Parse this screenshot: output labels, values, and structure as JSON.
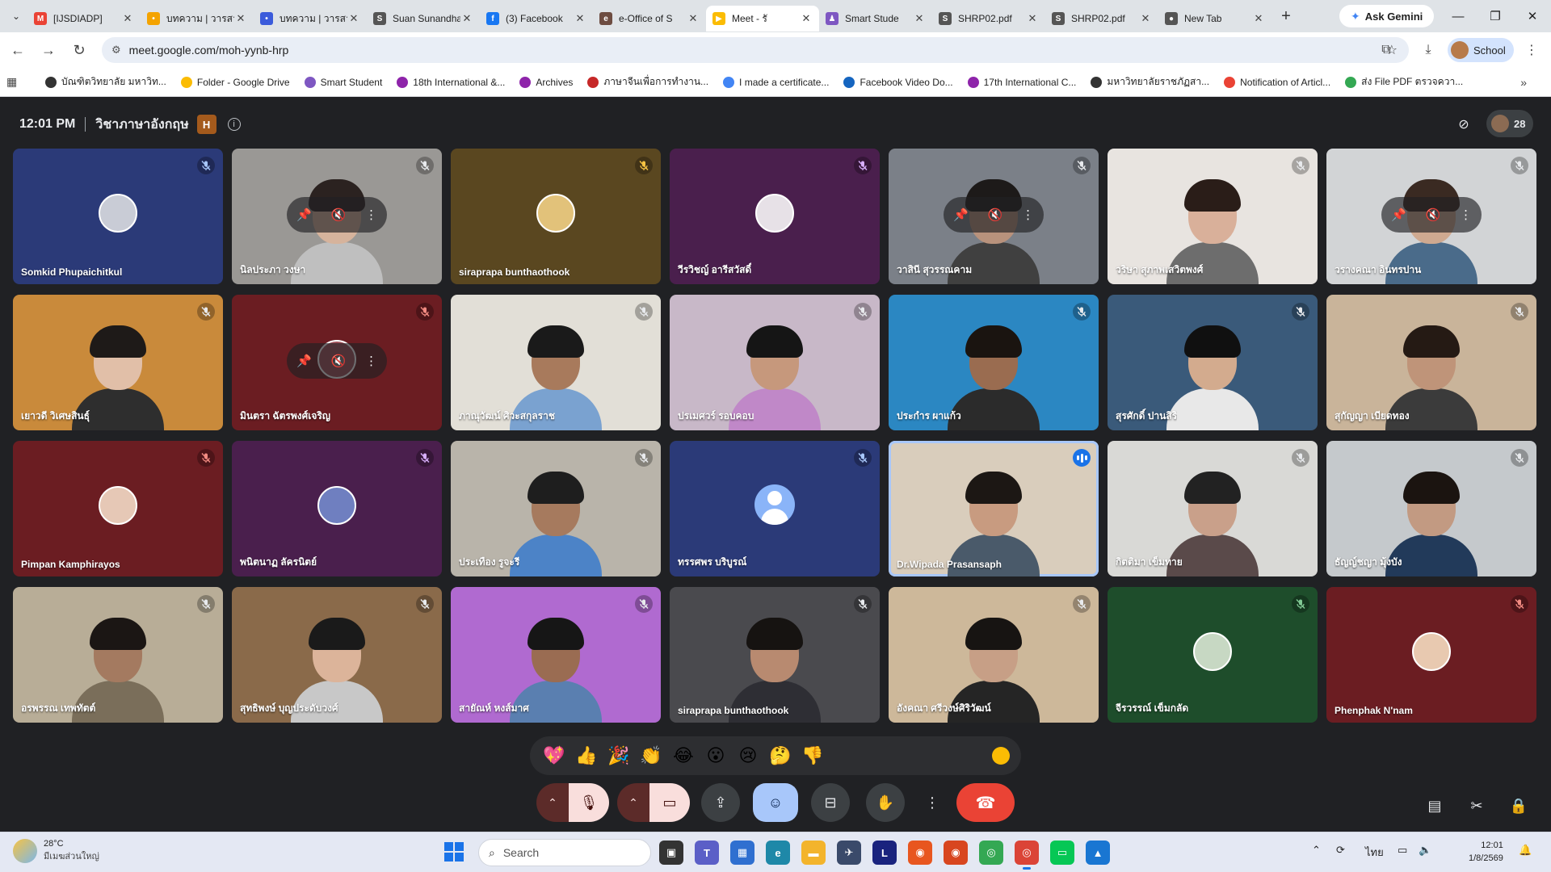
{
  "browser": {
    "tabs": [
      {
        "title": "[IJSDIADP]",
        "favicon": "M",
        "color": "#ea4335",
        "active": false
      },
      {
        "title": "บทความ | วารสาร",
        "favicon": "•",
        "color": "#f4a300",
        "active": false
      },
      {
        "title": "บทความ | วารสาร",
        "favicon": "•",
        "color": "#3b5bdb",
        "active": false
      },
      {
        "title": "Suan Sunandha",
        "favicon": "S",
        "color": "#555555",
        "active": false
      },
      {
        "title": "(3) Facebook",
        "favicon": "f",
        "color": "#1877f2",
        "active": false
      },
      {
        "title": "e-Office of S",
        "favicon": "e",
        "color": "#6d4c41",
        "active": false
      },
      {
        "title": "Meet - รั",
        "favicon": "▶",
        "color": "#fbbc04",
        "active": true
      },
      {
        "title": "Smart Stude",
        "favicon": "♟",
        "color": "#7e57c2",
        "active": false
      },
      {
        "title": "SHRP02.pdf",
        "favicon": "S",
        "color": "#555555",
        "active": false
      },
      {
        "title": "SHRP02.pdf",
        "favicon": "S",
        "color": "#555555",
        "active": false
      },
      {
        "title": "New Tab",
        "favicon": "●",
        "color": "#555555",
        "active": false
      }
    ],
    "close_glyph": "✕",
    "new_tab_glyph": "+",
    "gemini_label": "Ask Gemini",
    "url": "meet.google.com/moh-yynb-hrp",
    "profile_label": "School",
    "bookmarks": [
      {
        "label": "บัณฑิตวิทยาลัย มหาวิท...",
        "color": "#333333"
      },
      {
        "label": "Folder - Google Drive",
        "color": "#fbbc04"
      },
      {
        "label": "Smart Student",
        "color": "#7e57c2"
      },
      {
        "label": "18th International &...",
        "color": "#8e24aa"
      },
      {
        "label": "Archives",
        "color": "#8e24aa"
      },
      {
        "label": "ภาษาจีนเพื่อการทำงาน...",
        "color": "#c62828"
      },
      {
        "label": "I made a certificate...",
        "color": "#4285f4"
      },
      {
        "label": "Facebook Video Do...",
        "color": "#1565c0"
      },
      {
        "label": "17th International C...",
        "color": "#8e24aa"
      },
      {
        "label": "มหาวิทยาลัยราชภัฏสา...",
        "color": "#333333"
      },
      {
        "label": "Notification of Articl...",
        "color": "#ea4335"
      },
      {
        "label": "ส่ง File PDF ตรวจควา...",
        "color": "#34a853"
      }
    ]
  },
  "meet": {
    "time": "12:01 PM",
    "meeting_name": "วิชาภาษาอังกฤษ",
    "participant_count": "28",
    "tiles": [
      {
        "name": "Somkid Phupaichitkul",
        "bg": "#2b3a78",
        "kind": "avatar",
        "avatar": "#c9ccd6",
        "mic": "#a8c7fa"
      },
      {
        "name": "นิลประภา วงษา",
        "bg": "#9a9895",
        "kind": "video",
        "skin": "#d6b39c",
        "hair": "#2b2220",
        "shirt": "#bfbfbf",
        "hover": true
      },
      {
        "name": "siraprapa bunthaothook",
        "bg": "#5a4720",
        "kind": "avatar",
        "avatar": "#e2c27a",
        "mic": "#f6c343"
      },
      {
        "name": "วีรวิชญ์ อารีสวัสดิ์",
        "bg": "#4a1f4d",
        "kind": "avatar",
        "avatar": "#e7e1e7",
        "mic": "#d7aefb"
      },
      {
        "name": "วาสินี สุวรรณคาม",
        "bg": "#7b8088",
        "kind": "video",
        "skin": "#b8927c",
        "hair": "#1d1a19",
        "shirt": "#404040",
        "hover": true
      },
      {
        "name": "วริษา สุภาพเสวิตพงศ์",
        "bg": "#e8e4e0",
        "kind": "video",
        "skin": "#d9b09a",
        "hair": "#2a1d18",
        "shirt": "#6d6d6d"
      },
      {
        "name": "วรางคณา อินทรปาน",
        "bg": "#d2d4d6",
        "kind": "video",
        "skin": "#cfa990",
        "hair": "#3a2a22",
        "shirt": "#4a6b8a",
        "hover": true
      },
      {
        "name": "เยาวดี วิเศษสินธุ์",
        "bg": "#c98a3b",
        "kind": "video",
        "skin": "#e1bfa8",
        "hair": "#1e1a18",
        "shirt": "#2e2e2e"
      },
      {
        "name": "มินตรา ฉัตรพงศ์เจริญ",
        "bg": "#6b1d22",
        "kind": "avatar",
        "avatar": "#a0525a",
        "mic": "#f28b82",
        "hover": true
      },
      {
        "name": "ภาณุวัฒน์ ศิวะสกุลราช",
        "bg": "#e2dfd7",
        "kind": "video",
        "skin": "#a87a5c",
        "hair": "#1a1a1a",
        "shirt": "#7aa2d0"
      },
      {
        "name": "ปรเมศวร์ รอบคอบ",
        "bg": "#c8b8c8",
        "kind": "video",
        "skin": "#c6987c",
        "hair": "#151515",
        "shirt": "#c088c8"
      },
      {
        "name": "ประกำร ผาแก้ว",
        "bg": "#2b87c2",
        "kind": "video",
        "skin": "#9a6c50",
        "hair": "#1a1410",
        "shirt": "#2b2b2b"
      },
      {
        "name": "สุรศักดิ์ ปานสิริ",
        "bg": "#3a5a7a",
        "kind": "video",
        "skin": "#d3ab8e",
        "hair": "#101010",
        "shirt": "#e8e8e8"
      },
      {
        "name": "สุกัญญา เบียดทอง",
        "bg": "#c9b49a",
        "kind": "video",
        "skin": "#bf9479",
        "hair": "#251a14",
        "shirt": "#3b3b3b"
      },
      {
        "name": "Pimpan Kamphirayos",
        "bg": "#6b1d22",
        "kind": "avatar",
        "avatar": "#e6c8b6",
        "mic": "#f28b82"
      },
      {
        "name": "พนิตนาฏ ลัครนิตย์",
        "bg": "#4a1f4d",
        "kind": "avatar",
        "avatar": "#6f7fc0",
        "mic": "#d7aefb"
      },
      {
        "name": "ประเทือง รูจะรี",
        "bg": "#b9b4aa",
        "kind": "video",
        "skin": "#a67a5e",
        "hair": "#1e1e1e",
        "shirt": "#4c83c7"
      },
      {
        "name": "ทรรศพร บริบูรณ์",
        "bg": "#2b3a78",
        "kind": "generic",
        "mic": "#a8c7fa"
      },
      {
        "name": "Dr.Wipada Prasansaph",
        "bg": "#d9cdbc",
        "kind": "video",
        "skin": "#c89b80",
        "hair": "#1c1714",
        "shirt": "#4a5a6a",
        "speaking": true
      },
      {
        "name": "กิตติมา เข็มทาย",
        "bg": "#d9d9d6",
        "kind": "video",
        "skin": "#c9a08a",
        "hair": "#222222",
        "shirt": "#5a4a4a"
      },
      {
        "name": "ธัญญ์ชญา มุ้งบัง",
        "bg": "#c5c9cc",
        "kind": "video",
        "skin": "#c29a82",
        "hair": "#1b1410",
        "shirt": "#223a5a"
      },
      {
        "name": "อรพรรณ เทพทัตต์",
        "bg": "#b8ad97",
        "kind": "video",
        "skin": "#a47a60",
        "hair": "#1b1614",
        "shirt": "#7a6e5a"
      },
      {
        "name": "สุทธิพงษ์ บุญประดับวงศ์",
        "bg": "#8a6a4a",
        "kind": "video",
        "skin": "#dcb49a",
        "hair": "#1a1a1a",
        "shirt": "#c8c8c8"
      },
      {
        "name": "สายัณห์ หงส์มาศ",
        "bg": "#b06ad0",
        "kind": "video",
        "skin": "#9a6c52",
        "hair": "#161616",
        "shirt": "#5a7fb0"
      },
      {
        "name": "siraprapa bunthaothook",
        "bg": "#4a4a4e",
        "kind": "video",
        "skin": "#b88a70",
        "hair": "#161311",
        "shirt": "#2e2e34"
      },
      {
        "name": "อังคณา ศรีวงษ์ศิริวัฒน์",
        "bg": "#cdb89a",
        "kind": "video",
        "skin": "#c79f86",
        "hair": "#171412",
        "shirt": "#252525"
      },
      {
        "name": "จีรวรรณ์ เข็มกลัด",
        "bg": "#1e4d2b",
        "kind": "avatar",
        "avatar": "#c7d8c3",
        "mic": "#81c995"
      },
      {
        "name": "Phenphak N'nam",
        "bg": "#6b1d22",
        "kind": "avatar",
        "avatar": "#e8c9b0",
        "mic": "#f28b82"
      }
    ],
    "reactions": [
      "💖",
      "👍",
      "🎉",
      "👏",
      "😂",
      "😮",
      "😢",
      "🤔",
      "👎"
    ]
  },
  "taskbar": {
    "temperature": "28°C",
    "weather_desc": "มีเมฆส่วนใหญ่",
    "search_placeholder": "Search",
    "lang": "ไทย",
    "time": "12:01",
    "date": "1/8/2569"
  }
}
